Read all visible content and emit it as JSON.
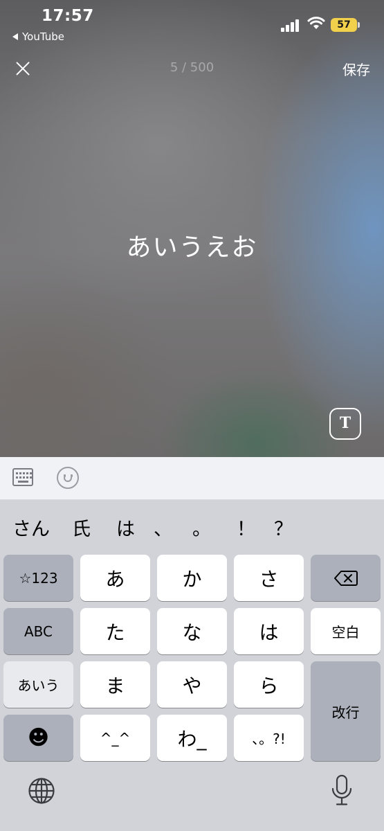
{
  "status_bar": {
    "time": "17:57",
    "back_app": "YouTube",
    "battery": "57",
    "battery_color": "#f1d04b"
  },
  "editor": {
    "char_count": "5 / 500",
    "save_label": "保存",
    "story_text": "あいうえお",
    "text_style_label": "T"
  },
  "accessory_bar": {
    "icons": [
      "keyboard-icon",
      "emoji-icon"
    ]
  },
  "keyboard": {
    "candidates": [
      "さん",
      "氏",
      "は",
      "、",
      "。",
      "！",
      "？"
    ],
    "keys": {
      "num_mode": "☆123",
      "abc_mode": "ABC",
      "kana_mode": "あいう",
      "a": "あ",
      "ka": "か",
      "sa": "さ",
      "ta": "た",
      "na": "な",
      "ha": "は",
      "ma": "ま",
      "ya": "や",
      "ra": "ら",
      "kaomoji": "^_^",
      "wa": "わ_",
      "punct": "、。?!",
      "space": "空白",
      "return": "改行",
      "emoji_face": "☻"
    }
  }
}
